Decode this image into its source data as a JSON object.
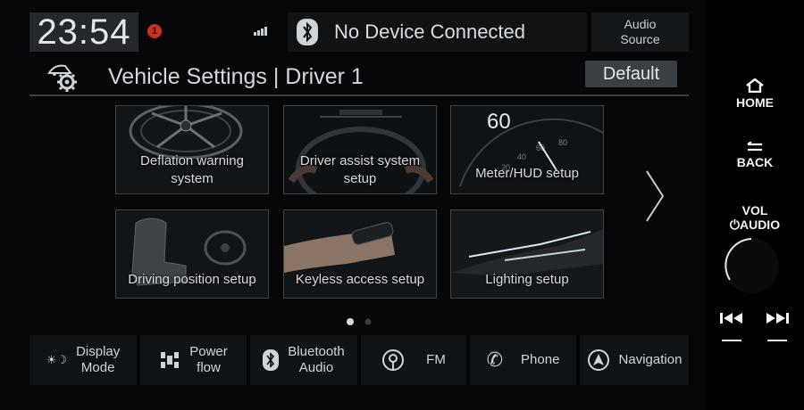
{
  "status": {
    "time": "23:54",
    "notification_count": "1",
    "bluetooth_status": "No Device Connected",
    "audio_source_line1": "Audio",
    "audio_source_line2": "Source"
  },
  "header": {
    "title": "Vehicle Settings | Driver 1",
    "default_button": "Default"
  },
  "tiles": [
    {
      "line1": "Deflation warning",
      "line2": "system",
      "icon": "wheel-icon"
    },
    {
      "line1": "Driver assist system",
      "line2": "setup",
      "icon": "steering-wheel-icon"
    },
    {
      "line1": "Meter/HUD setup",
      "line2": "",
      "icon": "speedometer-icon",
      "meter_value": "60"
    },
    {
      "line1": "Driving position setup",
      "line2": "",
      "icon": "seat-icon"
    },
    {
      "line1": "Keyless access setup",
      "line2": "",
      "icon": "key-fob-icon"
    },
    {
      "line1": "Lighting setup",
      "line2": "",
      "icon": "headlight-icon"
    }
  ],
  "pagination": {
    "current": 1,
    "total": 2
  },
  "bottom_bar": [
    {
      "line1": "Display",
      "line2": "Mode",
      "icon": "display-mode-icon"
    },
    {
      "line1": "Power",
      "line2": "flow",
      "icon": "power-flow-icon"
    },
    {
      "line1": "Bluetooth",
      "line2": "Audio",
      "icon": "bluetooth-icon"
    },
    {
      "line1": "FM",
      "line2": "",
      "icon": "fm-radio-icon"
    },
    {
      "line1": "Phone",
      "line2": "",
      "icon": "phone-icon"
    },
    {
      "line1": "Navigation",
      "line2": "",
      "icon": "navigation-icon"
    }
  ],
  "hardware": {
    "home": "HOME",
    "back": "BACK",
    "vol": "VOL",
    "audio": "AUDIO"
  },
  "colors": {
    "notification": "#c9321f",
    "background": "#050607",
    "tile_border": "#3e4347"
  }
}
